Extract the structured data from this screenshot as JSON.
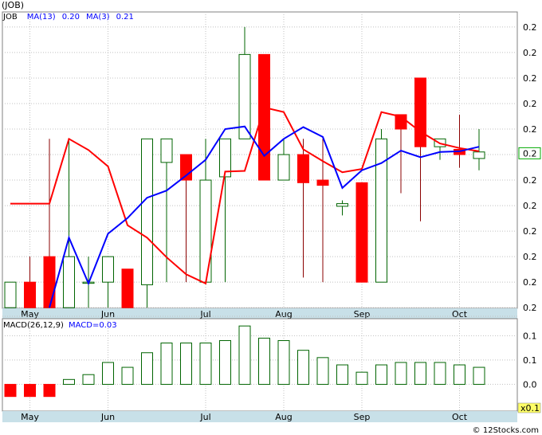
{
  "header": {
    "ticker_label": "(JOB)"
  },
  "copyright": "© 12Stocks.com",
  "colors": {
    "up": "#006400",
    "down": "#ff0000",
    "ma13": "#ff0000",
    "ma3": "#0000ff",
    "grid": "#c0c0c0",
    "axis_bg": "#c8e0e8",
    "last_box": "#00aa00"
  },
  "chart_data": [
    {
      "type": "candlestick",
      "legend": [
        {
          "text": "JOB",
          "color": "#000000"
        },
        {
          "text": "MA(13)",
          "color": "#0000ff"
        },
        {
          "text": "0.20",
          "color": "#0000ff"
        },
        {
          "text": "MA(3)",
          "color": "#0000ff"
        },
        {
          "text": "0.21",
          "color": "#0000ff"
        }
      ],
      "ylim": [
        0.1775,
        0.2228
      ],
      "y_tick_values": [
        0.1776,
        0.1815,
        0.1854,
        0.1893,
        0.1932,
        0.1971,
        0.201,
        0.2049,
        0.2088,
        0.2127,
        0.2166,
        0.2205
      ],
      "y_tick_labels": [
        "0.2",
        "0.2",
        "0.2",
        "0.2",
        "0.2",
        "0.2",
        "0.2",
        "0.2",
        "0.2",
        "0.2",
        "0.2",
        "0.2"
      ],
      "x_month_labels": [
        {
          "label": "May",
          "index": 1
        },
        {
          "label": "Jun",
          "index": 5
        },
        {
          "label": "Jul",
          "index": 10
        },
        {
          "label": "Aug",
          "index": 14
        },
        {
          "label": "Sep",
          "index": 18
        },
        {
          "label": "Oct",
          "index": 23
        }
      ],
      "last_value_label": "0.2",
      "last_value": 0.2012,
      "candles": [
        {
          "o": 0.1776,
          "h": 0.1815,
          "l": 0.1776,
          "c": 0.1815
        },
        {
          "o": 0.1815,
          "h": 0.1854,
          "l": 0.1776,
          "c": 0.1776
        },
        {
          "o": 0.1854,
          "h": 0.2034,
          "l": 0.1776,
          "c": 0.1776
        },
        {
          "o": 0.1776,
          "h": 0.2034,
          "l": 0.1776,
          "c": 0.1854
        },
        {
          "o": 0.1815,
          "h": 0.1854,
          "l": 0.1776,
          "c": 0.1815
        },
        {
          "o": 0.1815,
          "h": 0.1854,
          "l": 0.1776,
          "c": 0.1854
        },
        {
          "o": 0.1835,
          "h": 0.1835,
          "l": 0.1776,
          "c": 0.1776
        },
        {
          "o": 0.1811,
          "h": 0.2034,
          "l": 0.1776,
          "c": 0.2034
        },
        {
          "o": 0.1998,
          "h": 0.2034,
          "l": 0.1815,
          "c": 0.2034
        },
        {
          "o": 0.201,
          "h": 0.201,
          "l": 0.1815,
          "c": 0.1971
        },
        {
          "o": 0.1815,
          "h": 0.2034,
          "l": 0.1815,
          "c": 0.1971
        },
        {
          "o": 0.1976,
          "h": 0.2034,
          "l": 0.1815,
          "c": 0.2034
        },
        {
          "o": 0.2034,
          "h": 0.2205,
          "l": 0.2034,
          "c": 0.2163
        },
        {
          "o": 0.2163,
          "h": 0.2163,
          "l": 0.1971,
          "c": 0.1971
        },
        {
          "o": 0.1971,
          "h": 0.2034,
          "l": 0.1971,
          "c": 0.201
        },
        {
          "o": 0.201,
          "h": 0.2034,
          "l": 0.1822,
          "c": 0.1967
        },
        {
          "o": 0.1971,
          "h": 0.2034,
          "l": 0.1815,
          "c": 0.1963
        },
        {
          "o": 0.1931,
          "h": 0.194,
          "l": 0.1917,
          "c": 0.1935
        },
        {
          "o": 0.1967,
          "h": 0.1967,
          "l": 0.1815,
          "c": 0.1815
        },
        {
          "o": 0.1815,
          "h": 0.2049,
          "l": 0.1815,
          "c": 0.2034
        },
        {
          "o": 0.2071,
          "h": 0.2071,
          "l": 0.1951,
          "c": 0.2049
        },
        {
          "o": 0.2127,
          "h": 0.2127,
          "l": 0.1908,
          "c": 0.2022
        },
        {
          "o": 0.2022,
          "h": 0.2034,
          "l": 0.2002,
          "c": 0.2034
        },
        {
          "o": 0.2018,
          "h": 0.2071,
          "l": 0.199,
          "c": 0.201
        },
        {
          "o": 0.2004,
          "h": 0.2049,
          "l": 0.1986,
          "c": 0.2014
        }
      ],
      "ma13": [
        0.1935,
        0.1935,
        0.1935,
        0.2034,
        0.2017,
        0.1992,
        0.1902,
        0.1883,
        0.1853,
        0.1827,
        0.1813,
        0.1984,
        0.1985,
        0.2082,
        0.2075,
        0.2018,
        0.2,
        0.1983,
        0.1988,
        0.2075,
        0.2068,
        0.2045,
        0.2027,
        0.202,
        0.2015
      ],
      "ma13_start": 0,
      "ma3": [
        0.1776,
        0.1883,
        0.1813,
        0.1889,
        0.1913,
        0.1944,
        0.1955,
        0.1978,
        0.2002,
        0.2049,
        0.2053,
        0.2008,
        0.2034,
        0.2052,
        0.2037,
        0.1959,
        0.1986,
        0.1997,
        0.2016,
        0.2006,
        0.2014,
        0.2015,
        0.2022
      ],
      "ma3_start": 2
    },
    {
      "type": "bar",
      "title": "MACD(26,12,9)",
      "value_label": "MACD=0.03",
      "ylim": [
        -0.11,
        0.27
      ],
      "y_tick_values": [
        0.0,
        0.1,
        0.2
      ],
      "y_tick_labels": [
        "0.0",
        "0.1",
        "0.1",
        "0.1"
      ],
      "y_tick_positions_values": [
        0.0,
        0.1,
        0.2,
        0.28
      ],
      "x_month_labels": [
        {
          "label": "May",
          "index": 1
        },
        {
          "label": "Jun",
          "index": 5
        },
        {
          "label": "Jul",
          "index": 10
        },
        {
          "label": "Aug",
          "index": 14
        },
        {
          "label": "Sep",
          "index": 18
        },
        {
          "label": "Oct",
          "index": 23
        }
      ],
      "scale_label": "x0.1",
      "values": [
        -0.05,
        -0.05,
        -0.05,
        0.02,
        0.04,
        0.09,
        0.07,
        0.13,
        0.17,
        0.17,
        0.17,
        0.18,
        0.24,
        0.19,
        0.18,
        0.14,
        0.11,
        0.08,
        0.05,
        0.08,
        0.09,
        0.09,
        0.09,
        0.08,
        0.07
      ]
    }
  ]
}
